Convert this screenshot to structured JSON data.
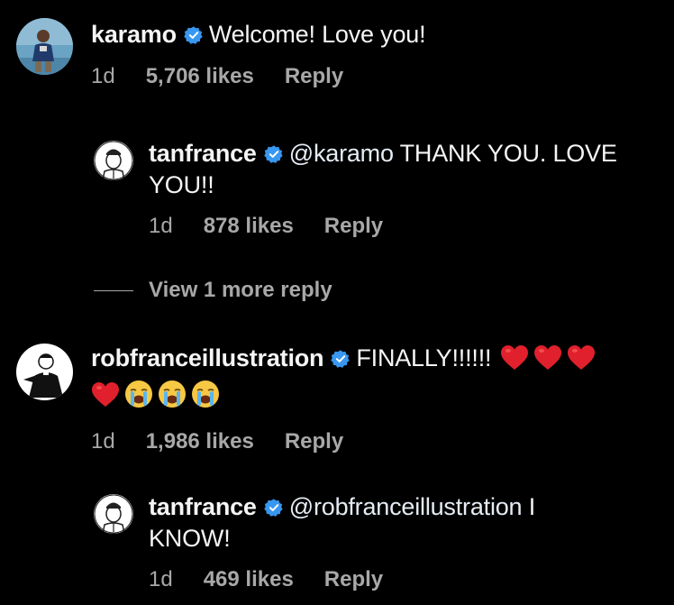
{
  "comments": [
    {
      "username": "karamo",
      "text": "Welcome! Love you!",
      "time": "1d",
      "likes": "5,706 likes",
      "reply_label": "Reply"
    },
    {
      "username": "tanfrance",
      "mention": "@karamo",
      "text_line1": " THANK YOU. LOVE",
      "text_line2": "YOU!!",
      "time": "1d",
      "likes": "878 likes",
      "reply_label": "Reply"
    },
    {
      "username": "robfranceillustration",
      "text": "FINALLY!!!!!!",
      "emojis_line1": [
        "red-heart",
        "red-heart",
        "red-heart"
      ],
      "emojis_line2": [
        "red-heart",
        "loudly-crying-face",
        "loudly-crying-face",
        "loudly-crying-face"
      ],
      "time": "1d",
      "likes": "1,986 likes",
      "reply_label": "Reply"
    },
    {
      "username": "tanfrance",
      "mention": "@robfranceillustration",
      "text_line1": " I",
      "text_line2": "KNOW!",
      "time": "1d",
      "likes": "469 likes",
      "reply_label": "Reply"
    }
  ],
  "view_more_label": "View 1 more reply",
  "colors": {
    "background": "#000000",
    "text": "#f5f5f5",
    "secondary": "#a8a8a8",
    "verified": "#3897f0",
    "heart": "#e0202c",
    "emoji_face": "#f7c844"
  }
}
